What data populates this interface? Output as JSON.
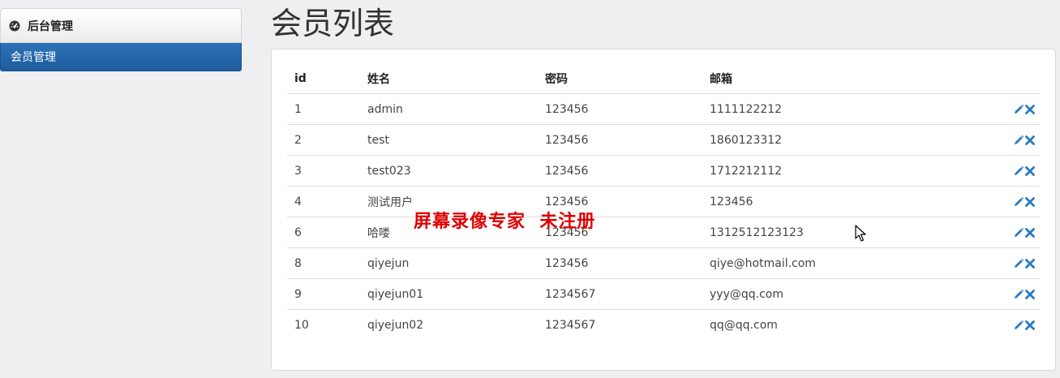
{
  "sidebar": {
    "header": {
      "title": "后台管理",
      "icon": "dashboard-icon"
    },
    "items": [
      {
        "label": "会员管理",
        "active": true
      }
    ],
    "active_color": "#2068ad"
  },
  "main": {
    "title": "会员列表",
    "table": {
      "columns": [
        "id",
        "姓名",
        "密码",
        "邮箱"
      ],
      "rows": [
        {
          "id": "1",
          "name": "admin",
          "password": "123456",
          "email": "1111122212"
        },
        {
          "id": "2",
          "name": "test",
          "password": "123456",
          "email": "1860123312"
        },
        {
          "id": "3",
          "name": "test023",
          "password": "123456",
          "email": "1712212112"
        },
        {
          "id": "4",
          "name": "测试用户",
          "password": "123456",
          "email": "123456"
        },
        {
          "id": "6",
          "name": "哈喽",
          "password": "123456",
          "email": "1312512123123"
        },
        {
          "id": "8",
          "name": "qiyejun",
          "password": "123456",
          "email": "qiye@hotmail.com"
        },
        {
          "id": "9",
          "name": "qiyejun01",
          "password": "1234567",
          "email": "yyy@qq.com"
        },
        {
          "id": "10",
          "name": "qiyejun02",
          "password": "1234567",
          "email": "qq@qq.com"
        }
      ],
      "row_actions": [
        {
          "icon": "pencil-icon",
          "name": "edit"
        },
        {
          "icon": "close-icon",
          "name": "delete"
        }
      ],
      "action_color": "#2a7ac0"
    }
  },
  "overlay": {
    "watermark": "屏幕录像专家  未注册",
    "watermark_color": "#e00000"
  }
}
